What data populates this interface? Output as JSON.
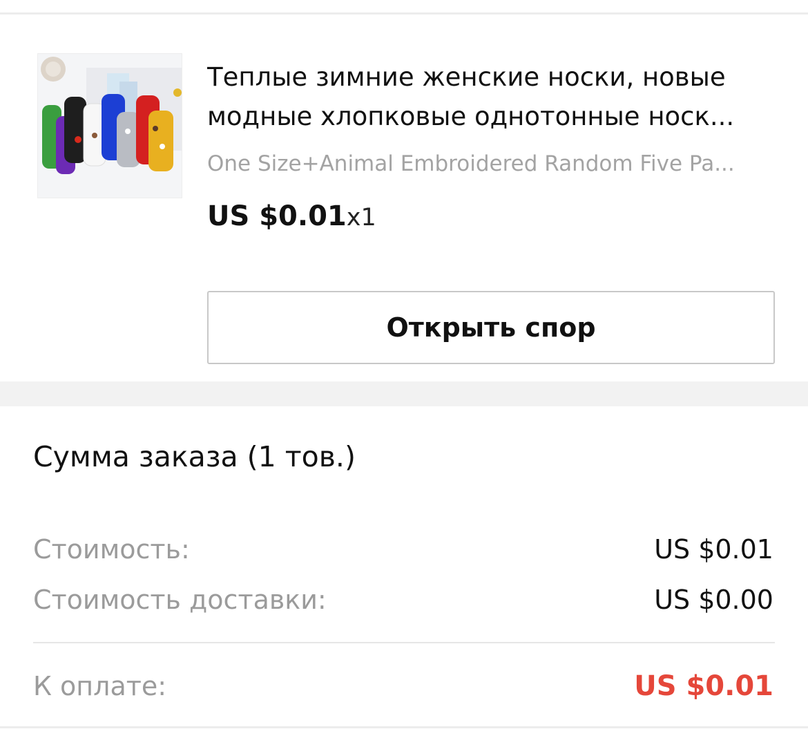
{
  "product": {
    "title_line1": "Теплые зимние женские носки, новые",
    "title_line2": "модные хлопковые однотонные носк...",
    "variant": "One Size+Animal Embroidered Random Five Pa...",
    "price": "US $0.01",
    "quantity": "x1",
    "image_icon": "socks-product-photo",
    "dispute_button": "Открыть спор"
  },
  "summary": {
    "title": "Сумма заказа (1 тов.)",
    "cost_label": "Стоимость:",
    "cost_value": "US $0.01",
    "shipping_label": "Стоимость доставки:",
    "shipping_value": "US $0.00",
    "total_label": "К оплате:",
    "total_value": "US $0.01"
  },
  "colors": {
    "accent_total": "#e5473a",
    "muted_text": "#9b9b9b",
    "divider": "#ececec"
  }
}
